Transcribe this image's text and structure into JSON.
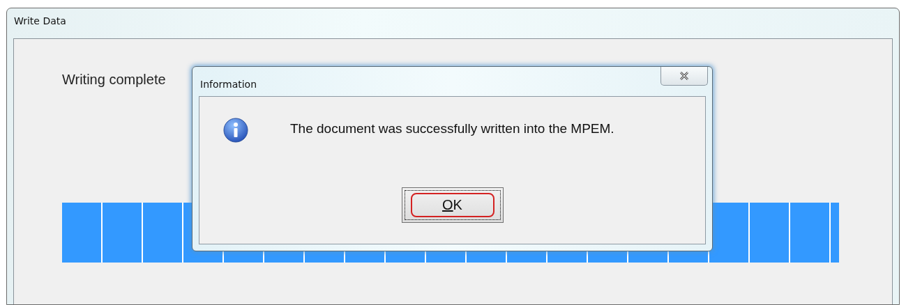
{
  "window": {
    "title": "Write Data"
  },
  "status_text": "Writing complete",
  "progress": {
    "level": 1
  },
  "dialog": {
    "title": "Information",
    "message": "The document was successfully written into the MPEM.",
    "button": {
      "label": "OK",
      "mnemonic_underlined": true,
      "highlighted": true
    }
  }
}
